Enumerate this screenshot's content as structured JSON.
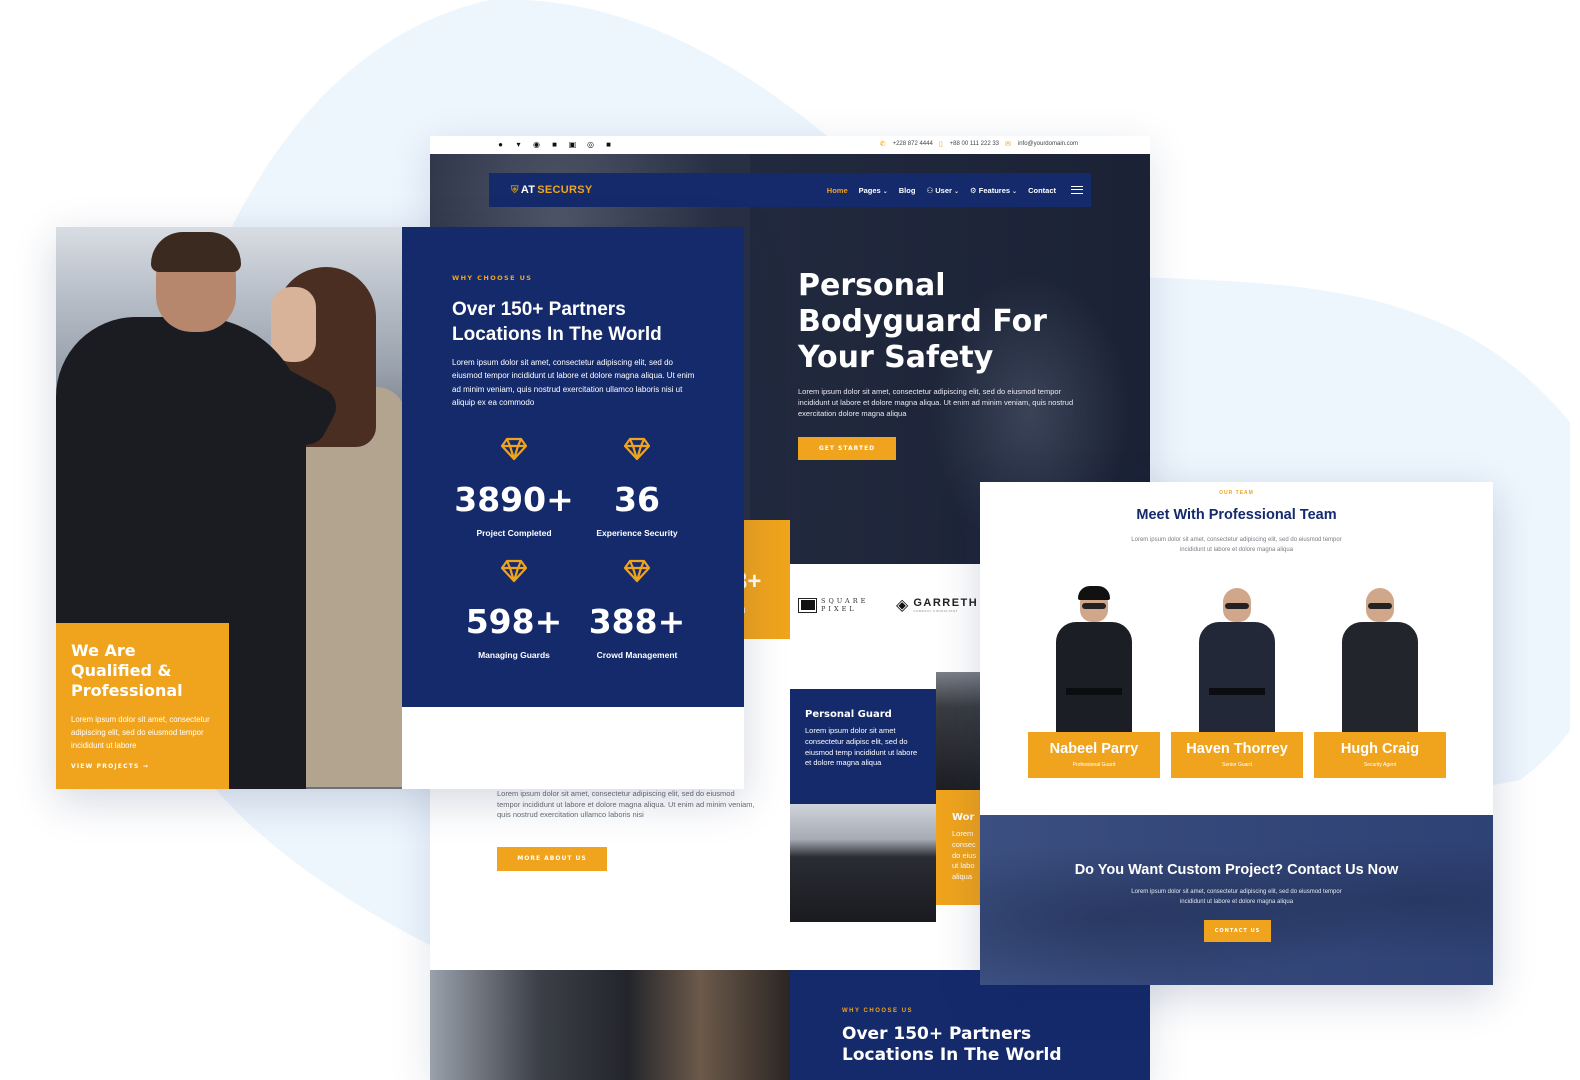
{
  "colors": {
    "navy": "#142a6b",
    "accent": "#f0a41d",
    "background_blob": "#edf5fd"
  },
  "topbar": {
    "socials": [
      {
        "icon": "facebook-icon",
        "glyph": "f"
      },
      {
        "icon": "twitter-icon",
        "glyph": "t"
      },
      {
        "icon": "pinterest-icon",
        "glyph": "p"
      },
      {
        "icon": "youtube-icon",
        "glyph": "▶"
      },
      {
        "icon": "linkedin-icon",
        "glyph": "in"
      },
      {
        "icon": "instagram-icon",
        "glyph": "◎"
      },
      {
        "icon": "flickr-icon",
        "glyph": "••"
      }
    ],
    "phone1": "+228 872 4444",
    "phone2": "+88 00 111 222 33",
    "email": "info@yourdomain.com"
  },
  "navbar": {
    "logo_prefix": "AT",
    "logo_accent": "SECURSY",
    "items": [
      {
        "label": "Home",
        "active": true,
        "dropdown": false
      },
      {
        "label": "Pages",
        "active": false,
        "dropdown": true
      },
      {
        "label": "Blog",
        "active": false,
        "dropdown": false
      },
      {
        "label": "User",
        "active": false,
        "dropdown": true
      },
      {
        "label": "Features",
        "active": false,
        "dropdown": true
      },
      {
        "label": "Contact",
        "active": false,
        "dropdown": false
      }
    ]
  },
  "hero": {
    "title_line1": "Personal",
    "title_line2": "Bodyguard For",
    "title_line3": "Your Safety",
    "description": "Lorem ipsum dolor sit amet, consectetur adipiscing elit, sed do eiusmod tempor incididunt ut labore et dolore magna aliqua. Ut enim ad minim veniam, quis nostrud exercitation dolore magna aliqua",
    "button": "GET STARTED"
  },
  "partial_stat": {
    "value": "3+",
    "label": "ted"
  },
  "partner_logos": {
    "square_pixel_line1": "SQUARE",
    "square_pixel_line2": "PIXEL",
    "garreth": "GARRETH",
    "garreth_sub": "COMPANY CONSULTANT"
  },
  "about": {
    "description": "Lorem ipsum dolor sit amet, consectetur adipiscing elit, sed do eiusmod tempor incididunt ut labore et dolore magna aliqua. Ut enim ad minim veniam, quis nostrud exercitation ullamco laboris nisi",
    "button": "MORE ABOUT US"
  },
  "services": [
    {
      "title": "Personal Guard",
      "description": "Lorem ipsum dolor sit amet consectetur adipisc elit, sed do eiusmod temp incididunt ut labore et dolore magna aliqua"
    },
    {
      "title": "Wor",
      "description": "Lorem\nconsec\ndo eius\nut labo\naliqua"
    }
  ],
  "why_choose": {
    "tag": "WHY CHOOSE US",
    "title_line1": "Over 150+ Partners",
    "title_line2": "Locations In The World",
    "description": "Lorem ipsum dolor sit amet, consectetur adipiscing elit, sed do eiusmod tempor incididunt ut labore et dolore magna aliqua. Ut enim ad minim veniam, quis nostrud exercitation ullamco laboris nisi ut aliquip ex ea commodo",
    "stats": [
      {
        "value": "3890+",
        "label": "Project Completed"
      },
      {
        "value": "36",
        "label": "Experience Security"
      },
      {
        "value": "598+",
        "label": "Managing Guards"
      },
      {
        "value": "388+",
        "label": "Crowd Management"
      }
    ]
  },
  "qualified": {
    "title_line1": "We Are",
    "title_line2": "Qualified &",
    "title_line3": "Professional",
    "description": "Lorem ipsum dolor sit amet, consectetur adipiscing elit, sed do eiusmod tempor incididunt ut labore",
    "link": "VIEW PROJECTS",
    "link_icon": "→"
  },
  "team": {
    "tag": "OUR TEAM",
    "title": "Meet With Professional Team",
    "description": "Lorem ipsum dolor sit amet, consectetur adipiscing elit, sed do eiusmod tempor incididunt ut labore et dolore magna aliqua",
    "members": [
      {
        "name": "Nabeel Parry",
        "role": "Professional Guard"
      },
      {
        "name": "Haven Thorrey",
        "role": "Senior Guard"
      },
      {
        "name": "Hugh Craig",
        "role": "Security Agent"
      }
    ]
  },
  "cta": {
    "title": "Do You Want Custom Project? Contact Us Now",
    "description": "Lorem ipsum dolor sit amet, consectetur adipiscing elit, sed do eiusmod tempor incididunt ut labore et dolore magna aliqua",
    "button": "CONTACT US"
  }
}
